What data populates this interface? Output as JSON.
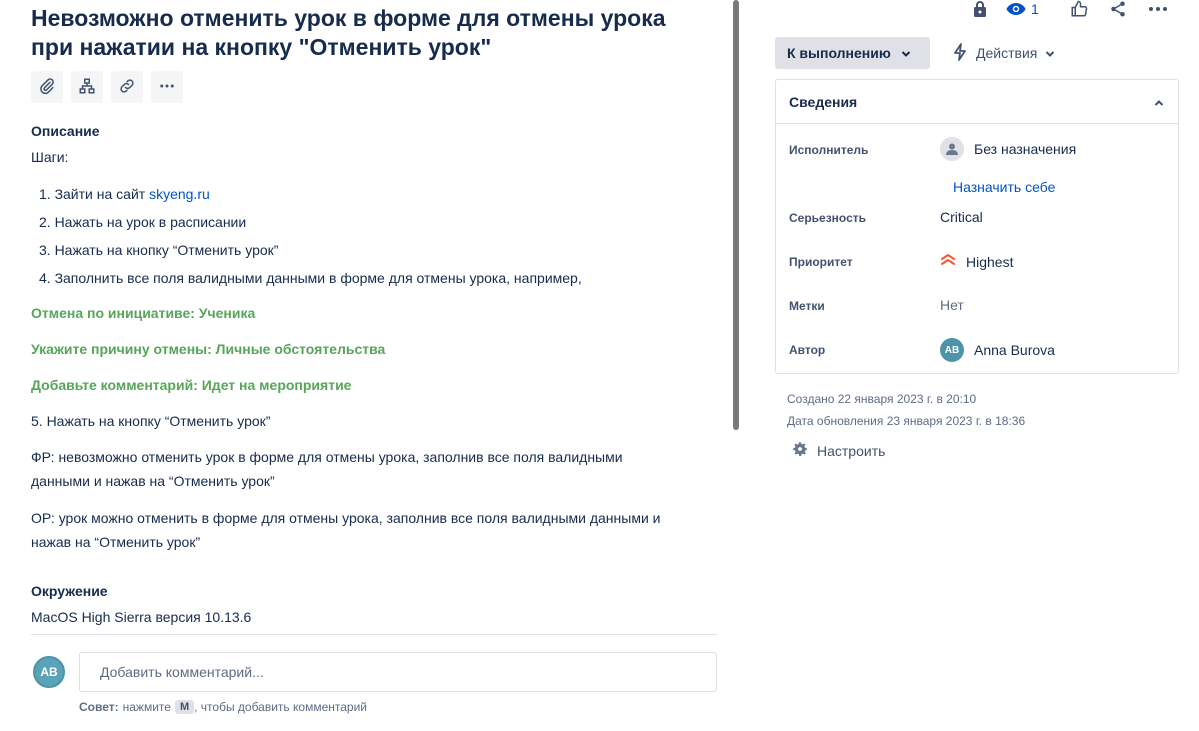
{
  "issue": {
    "title": "Невозможно отменить урок в форме для отмены урока при нажатии на кнопку \"Отменить урок\""
  },
  "toolbar": {
    "buttons": [
      "paperclip-icon",
      "hierarchy-icon",
      "link-icon",
      "more-icon"
    ]
  },
  "description": {
    "heading": "Описание",
    "steps_label": "Шаги:",
    "steps": [
      {
        "prefix": "1. Зайти на сайт ",
        "link": "skyeng.ru"
      },
      {
        "text": "2. Нажать на урок в расписании"
      },
      {
        "text": "3. Нажать на кнопку “Отменить урок”"
      },
      {
        "text": "4. Заполнить все поля валидными данными в форме для отмены урока, например,"
      }
    ],
    "highlights": [
      "Отмена по инициативе: Ученика",
      "Укажите причину отмены: Личные обстоятельства",
      "Добавьте комментарий: Идет на мероприятие"
    ],
    "step5": "5. Нажать на кнопку “Отменить урок”",
    "actual_line1": "ФР: невозможно отменить урок в форме для отмены урока, заполнив все поля валидными",
    "actual_line2": "данными и нажав на “Отменить урок”",
    "expected_line1": "ОР: урок можно отменить в форме для отмены урока, заполнив все поля валидными данными и",
    "expected_line2": "нажав на “Отменить урок”"
  },
  "environment": {
    "heading": "Окружение",
    "value": "MacOS High Sierra версия 10.13.6"
  },
  "comment": {
    "avatar_initials": "AB",
    "placeholder": "Добавить комментарий...",
    "tip_bold": "Совет:",
    "tip_pre": "нажмите",
    "tip_key": "M",
    "tip_post": ", чтобы добавить комментарий"
  },
  "header_actions": {
    "watch_count": "1"
  },
  "status": {
    "label": "К выполнению"
  },
  "actions": {
    "label": "Действия"
  },
  "details": {
    "heading": "Сведения",
    "assignee_label": "Исполнитель",
    "assignee_value": "Без назначения",
    "assign_me": "Назначить себе",
    "severity_label": "Серьезность",
    "severity_value": "Critical",
    "priority_label": "Приоритет",
    "priority_value": "Highest",
    "labels_label": "Метки",
    "labels_value": "Нет",
    "reporter_label": "Автор",
    "reporter_initials": "AB",
    "reporter_value": "Anna Burova"
  },
  "meta": {
    "created": "Создано 22 января 2023 г. в 20:10",
    "updated": "Дата обновления 23 января 2023 г. в 18:36",
    "configure": "Настроить"
  },
  "colors": {
    "link": "#0052cc",
    "green_text": "#57a55a",
    "priority_highest": "#ff5630"
  }
}
